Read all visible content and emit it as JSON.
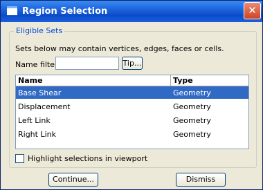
{
  "window": {
    "title": "Region Selection",
    "close_glyph": "✕"
  },
  "group": {
    "legend": "Eligible Sets",
    "description": "Sets below may contain vertices, edges, faces or cells."
  },
  "filter": {
    "label": "Name filter:",
    "value": "",
    "tip_label": "Tip..."
  },
  "table": {
    "columns": [
      "Name",
      "Type"
    ],
    "rows": [
      {
        "name": "Base Shear",
        "type": "Geometry",
        "selected": true
      },
      {
        "name": "Displacement",
        "type": "Geometry",
        "selected": false
      },
      {
        "name": "Left Link",
        "type": "Geometry",
        "selected": false
      },
      {
        "name": "Right Link",
        "type": "Geometry",
        "selected": false
      }
    ]
  },
  "highlight": {
    "label": "Highlight selections in viewport",
    "checked": false
  },
  "buttons": {
    "continue": "Continue...",
    "dismiss": "Dismiss"
  },
  "colors": {
    "selection": "#316ac5",
    "titlebar": "#0a4bc7",
    "legend": "#0046d5"
  }
}
